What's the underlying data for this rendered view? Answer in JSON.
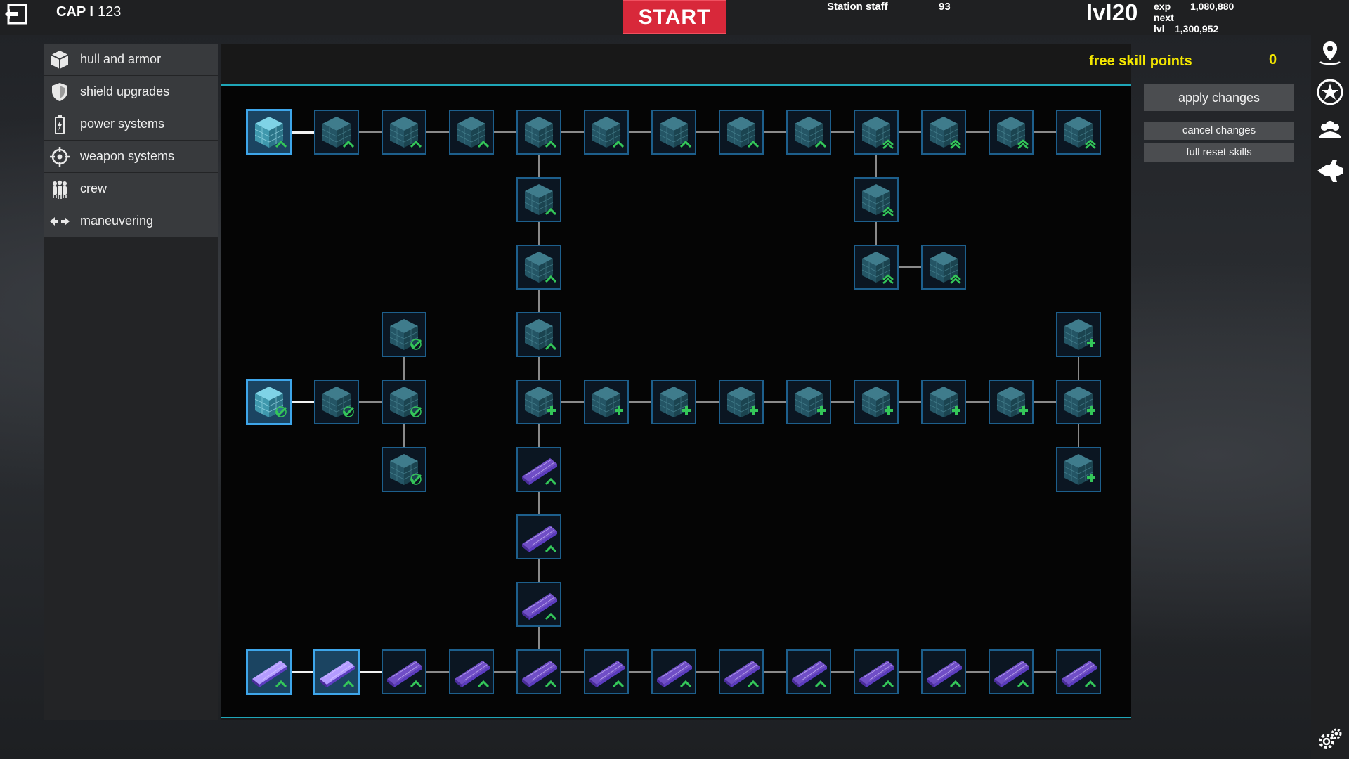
{
  "topbar": {
    "cap_label": "CAP I",
    "cap_value": "123",
    "start_label": "START",
    "staff_label": "Station staff",
    "staff_value": "93",
    "level": "lvl20",
    "exp_label": "exp",
    "exp_value": "1,080,880",
    "next_label": "next lvl",
    "next_value": "1,300,952"
  },
  "categories": [
    {
      "label": "hull and armor",
      "icon": "cube-icon"
    },
    {
      "label": "shield upgrades",
      "icon": "shield-icon"
    },
    {
      "label": "power systems",
      "icon": "battery-icon"
    },
    {
      "label": "weapon systems",
      "icon": "crosshair-icon"
    },
    {
      "label": "crew",
      "icon": "crew-icon"
    },
    {
      "label": "maneuvering",
      "icon": "arrows-icon"
    }
  ],
  "skill_points": {
    "label": "free skill points",
    "value": "0"
  },
  "actions": {
    "apply": "apply changes",
    "cancel": "cancel changes",
    "reset": "full reset skills"
  },
  "right_icons": [
    "map-pin-icon",
    "star-icon",
    "group-icon",
    "ship-icon"
  ],
  "settings_icon": "gears-icon",
  "colors": {
    "start": "#d8283a",
    "skill_points": "#f3e600",
    "accent": "#1fa6b8",
    "node_border": "#1d5f8c",
    "node_unlocked": "#3ea6ea",
    "upgrade_green": "#34c759",
    "plate_purple": "#8a5cf0"
  },
  "skill_tree": {
    "nodes": [
      {
        "id": "a0",
        "col": 0,
        "row": 0,
        "kind": "cube",
        "badge": "chevron",
        "unlocked": true
      },
      {
        "id": "a1",
        "col": 1,
        "row": 0,
        "kind": "cube",
        "badge": "chevron",
        "unlocked": false
      },
      {
        "id": "a2",
        "col": 2,
        "row": 0,
        "kind": "cube",
        "badge": "chevron",
        "unlocked": false
      },
      {
        "id": "a3",
        "col": 3,
        "row": 0,
        "kind": "cube",
        "badge": "chevron",
        "unlocked": false
      },
      {
        "id": "a4",
        "col": 4,
        "row": 0,
        "kind": "cube",
        "badge": "chevron",
        "unlocked": false
      },
      {
        "id": "a5",
        "col": 5,
        "row": 0,
        "kind": "cube",
        "badge": "chevron",
        "unlocked": false
      },
      {
        "id": "a6",
        "col": 6,
        "row": 0,
        "kind": "cube",
        "badge": "chevron",
        "unlocked": false
      },
      {
        "id": "a7",
        "col": 7,
        "row": 0,
        "kind": "cube",
        "badge": "chevron",
        "unlocked": false
      },
      {
        "id": "a8",
        "col": 8,
        "row": 0,
        "kind": "cube",
        "badge": "chevron",
        "unlocked": false
      },
      {
        "id": "a9",
        "col": 9,
        "row": 0,
        "kind": "cube",
        "badge": "chevron2",
        "unlocked": false
      },
      {
        "id": "a10",
        "col": 10,
        "row": 0,
        "kind": "cube",
        "badge": "chevron2",
        "unlocked": false
      },
      {
        "id": "a11",
        "col": 11,
        "row": 0,
        "kind": "cube",
        "badge": "chevron2",
        "unlocked": false
      },
      {
        "id": "a12",
        "col": 12,
        "row": 0,
        "kind": "cube",
        "badge": "chevron2",
        "unlocked": false
      },
      {
        "id": "b4",
        "col": 4,
        "row": 1,
        "kind": "cube",
        "badge": "chevron",
        "unlocked": false
      },
      {
        "id": "b9",
        "col": 9,
        "row": 1,
        "kind": "cube",
        "badge": "chevron2",
        "unlocked": false
      },
      {
        "id": "c4",
        "col": 4,
        "row": 2,
        "kind": "cube",
        "badge": "chevron",
        "unlocked": false
      },
      {
        "id": "c9",
        "col": 9,
        "row": 2,
        "kind": "cube",
        "badge": "chevron2",
        "unlocked": false
      },
      {
        "id": "c10",
        "col": 10,
        "row": 2,
        "kind": "cube",
        "badge": "chevron2",
        "unlocked": false
      },
      {
        "id": "d2",
        "col": 2,
        "row": 3,
        "kind": "cube",
        "badge": "check",
        "unlocked": false
      },
      {
        "id": "d4",
        "col": 4,
        "row": 3,
        "kind": "cube",
        "badge": "chevron",
        "unlocked": false
      },
      {
        "id": "d12",
        "col": 12,
        "row": 3,
        "kind": "cube",
        "badge": "plus",
        "unlocked": false
      },
      {
        "id": "e0",
        "col": 0,
        "row": 4,
        "kind": "cube",
        "badge": "check",
        "unlocked": true
      },
      {
        "id": "e1",
        "col": 1,
        "row": 4,
        "kind": "cube",
        "badge": "check",
        "unlocked": false
      },
      {
        "id": "e2",
        "col": 2,
        "row": 4,
        "kind": "cube",
        "badge": "check",
        "unlocked": false
      },
      {
        "id": "e4",
        "col": 4,
        "row": 4,
        "kind": "cube",
        "badge": "plus",
        "unlocked": false
      },
      {
        "id": "e5",
        "col": 5,
        "row": 4,
        "kind": "cube",
        "badge": "plus",
        "unlocked": false
      },
      {
        "id": "e6",
        "col": 6,
        "row": 4,
        "kind": "cube",
        "badge": "plus",
        "unlocked": false
      },
      {
        "id": "e7",
        "col": 7,
        "row": 4,
        "kind": "cube",
        "badge": "plus",
        "unlocked": false
      },
      {
        "id": "e8",
        "col": 8,
        "row": 4,
        "kind": "cube",
        "badge": "plus",
        "unlocked": false
      },
      {
        "id": "e9",
        "col": 9,
        "row": 4,
        "kind": "cube",
        "badge": "plus",
        "unlocked": false
      },
      {
        "id": "e10",
        "col": 10,
        "row": 4,
        "kind": "cube",
        "badge": "plus",
        "unlocked": false
      },
      {
        "id": "e11",
        "col": 11,
        "row": 4,
        "kind": "cube",
        "badge": "plus",
        "unlocked": false
      },
      {
        "id": "e12",
        "col": 12,
        "row": 4,
        "kind": "cube",
        "badge": "plus",
        "unlocked": false
      },
      {
        "id": "f2",
        "col": 2,
        "row": 5,
        "kind": "cube",
        "badge": "check",
        "unlocked": false
      },
      {
        "id": "f4",
        "col": 4,
        "row": 5,
        "kind": "plate",
        "badge": "chevron",
        "unlocked": false
      },
      {
        "id": "f12",
        "col": 12,
        "row": 5,
        "kind": "cube",
        "badge": "plus",
        "unlocked": false
      },
      {
        "id": "g4",
        "col": 4,
        "row": 6,
        "kind": "plate",
        "badge": "chevron",
        "unlocked": false
      },
      {
        "id": "h4",
        "col": 4,
        "row": 7,
        "kind": "plate",
        "badge": "chevron",
        "unlocked": false
      },
      {
        "id": "i0",
        "col": 0,
        "row": 8,
        "kind": "plate",
        "badge": "chevron",
        "unlocked": true
      },
      {
        "id": "i1",
        "col": 1,
        "row": 8,
        "kind": "plate",
        "badge": "chevron",
        "unlocked": true
      },
      {
        "id": "i2",
        "col": 2,
        "row": 8,
        "kind": "plate",
        "badge": "chevron",
        "unlocked": false
      },
      {
        "id": "i3",
        "col": 3,
        "row": 8,
        "kind": "plate",
        "badge": "chevron",
        "unlocked": false
      },
      {
        "id": "i4",
        "col": 4,
        "row": 8,
        "kind": "plate",
        "badge": "chevron",
        "unlocked": false
      },
      {
        "id": "i5",
        "col": 5,
        "row": 8,
        "kind": "plate",
        "badge": "chevron",
        "unlocked": false
      },
      {
        "id": "i6",
        "col": 6,
        "row": 8,
        "kind": "plate",
        "badge": "chevron",
        "unlocked": false
      },
      {
        "id": "i7",
        "col": 7,
        "row": 8,
        "kind": "plate",
        "badge": "chevron",
        "unlocked": false
      },
      {
        "id": "i8",
        "col": 8,
        "row": 8,
        "kind": "plate",
        "badge": "chevron",
        "unlocked": false
      },
      {
        "id": "i9",
        "col": 9,
        "row": 8,
        "kind": "plate",
        "badge": "chevron",
        "unlocked": false
      },
      {
        "id": "i10",
        "col": 10,
        "row": 8,
        "kind": "plate",
        "badge": "chevron",
        "unlocked": false
      },
      {
        "id": "i11",
        "col": 11,
        "row": 8,
        "kind": "plate",
        "badge": "chevron",
        "unlocked": false
      },
      {
        "id": "i12",
        "col": 12,
        "row": 8,
        "kind": "plate",
        "badge": "chevron",
        "unlocked": false
      }
    ],
    "edges": [
      [
        "a0",
        "a1",
        true
      ],
      [
        "a1",
        "a2",
        false
      ],
      [
        "a2",
        "a3",
        false
      ],
      [
        "a3",
        "a4",
        false
      ],
      [
        "a4",
        "a5",
        false
      ],
      [
        "a5",
        "a6",
        false
      ],
      [
        "a6",
        "a7",
        false
      ],
      [
        "a7",
        "a8",
        false
      ],
      [
        "a8",
        "a9",
        false
      ],
      [
        "a9",
        "a10",
        false
      ],
      [
        "a10",
        "a11",
        false
      ],
      [
        "a11",
        "a12",
        false
      ],
      [
        "a4",
        "b4",
        false
      ],
      [
        "b4",
        "c4",
        false
      ],
      [
        "c4",
        "d4",
        false
      ],
      [
        "d4",
        "e4",
        false
      ],
      [
        "e4",
        "f4",
        false
      ],
      [
        "f4",
        "g4",
        false
      ],
      [
        "g4",
        "h4",
        false
      ],
      [
        "h4",
        "i4",
        false
      ],
      [
        "a9",
        "b9",
        false
      ],
      [
        "b9",
        "c9",
        false
      ],
      [
        "c9",
        "c10",
        false
      ],
      [
        "d2",
        "e2",
        false
      ],
      [
        "e2",
        "f2",
        false
      ],
      [
        "e0",
        "e1",
        true
      ],
      [
        "e1",
        "e2",
        false
      ],
      [
        "e4",
        "e5",
        false
      ],
      [
        "e5",
        "e6",
        false
      ],
      [
        "e6",
        "e7",
        false
      ],
      [
        "e7",
        "e8",
        false
      ],
      [
        "e8",
        "e9",
        false
      ],
      [
        "e9",
        "e10",
        false
      ],
      [
        "e10",
        "e11",
        false
      ],
      [
        "e11",
        "e12",
        false
      ],
      [
        "d12",
        "e12",
        false
      ],
      [
        "e12",
        "f12",
        false
      ],
      [
        "i0",
        "i1",
        true
      ],
      [
        "i1",
        "i2",
        true
      ],
      [
        "i2",
        "i3",
        false
      ],
      [
        "i3",
        "i4",
        false
      ],
      [
        "i4",
        "i5",
        false
      ],
      [
        "i5",
        "i6",
        false
      ],
      [
        "i6",
        "i7",
        false
      ],
      [
        "i7",
        "i8",
        false
      ],
      [
        "i8",
        "i9",
        false
      ],
      [
        "i9",
        "i10",
        false
      ],
      [
        "i10",
        "i11",
        false
      ],
      [
        "i11",
        "i12",
        false
      ]
    ]
  }
}
